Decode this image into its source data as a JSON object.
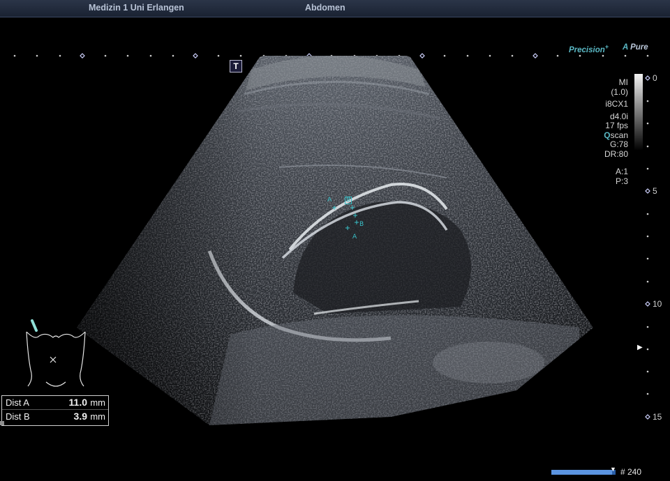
{
  "header": {
    "institution": "Medizin 1 Uni Erlangen",
    "study": "Abdomen"
  },
  "branding": {
    "precision": "Precision",
    "precision_suffix": "+",
    "pure_prefix": "A",
    "pure": "Pure"
  },
  "toolbar": {
    "t_marker": "T"
  },
  "params": {
    "mi_label": "MI",
    "mi_value": "(1.0)",
    "transducer": "i8CX1",
    "depth_mode": "d4.0i",
    "fps": "17 fps",
    "qscan_q": "Q",
    "qscan_rest": "scan",
    "gain": "G:78",
    "dynamic_range": "DR:80",
    "a": "A:1",
    "p": "P:3"
  },
  "depth_scale": {
    "labels": [
      "0",
      "5",
      "10",
      "15"
    ],
    "focus_marker": "▶"
  },
  "calipers": {
    "a_label": "A",
    "b_label": "B"
  },
  "measurements": [
    {
      "label": "Dist A",
      "value": "11.0",
      "unit": "mm"
    },
    {
      "label": "Dist B",
      "value": "3.9",
      "unit": "mm"
    }
  ],
  "cine": {
    "frame": "# 240",
    "progress": 0.95
  },
  "colors": {
    "accent": "#5ab8c4",
    "caliper": "#39c0c8",
    "cine": "#2b5fa8"
  },
  "icons": {
    "body_marker": "body-outline-icon",
    "probe": "probe-position-icon"
  }
}
